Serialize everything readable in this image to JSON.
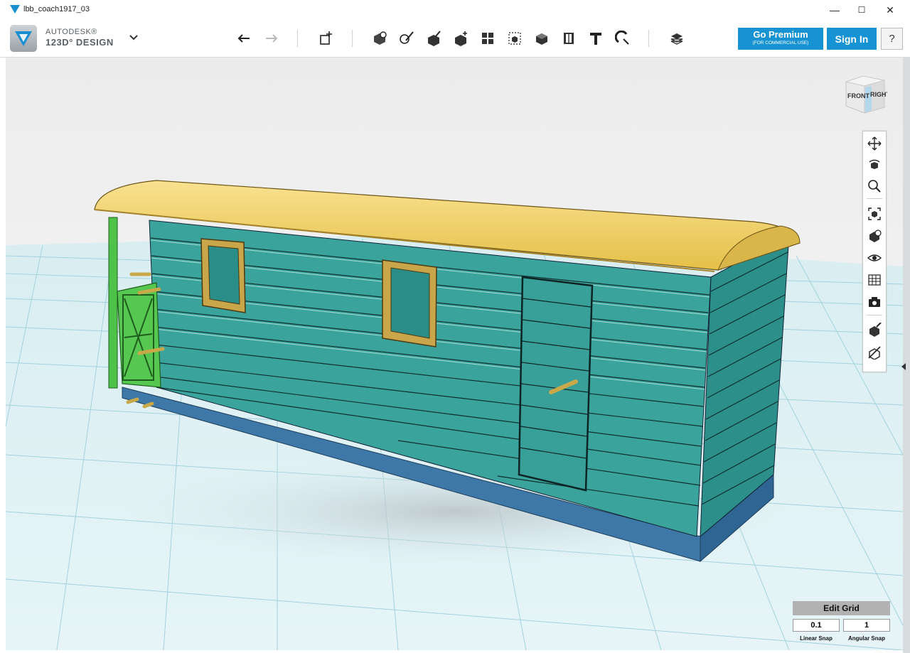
{
  "window": {
    "title": "lbb_coach1917_03",
    "minimize": "—",
    "maximize": "☐",
    "close": "✕"
  },
  "brand": {
    "line1": "AUTODESK®",
    "line2": "123D° DESIGN"
  },
  "toolbar": {
    "icons": [
      "undo-icon",
      "redo-icon",
      "primitives-icon",
      "sketch-icon",
      "construct-icon",
      "modify-icon",
      "pattern-icon",
      "grouping-icon",
      "combine-icon",
      "measure-icon",
      "text-icon",
      "snap-icon",
      "material-icon"
    ]
  },
  "account": {
    "premium_label": "Go Premium",
    "premium_sub": "(FOR COMMERCIAL USE)",
    "signin_label": "Sign In",
    "help_label": "?"
  },
  "viewcube": {
    "front": "FRONT",
    "right": "RIGHT"
  },
  "navbar": {
    "icons": [
      "pan-icon",
      "orbit-icon",
      "zoom-icon",
      "fit-icon",
      "view-icon",
      "visibility-icon",
      "materials-outline-icon",
      "screenshot-icon",
      "solid-icon",
      "hide-sketch-icon"
    ]
  },
  "grid": {
    "title": "Edit Grid",
    "linear_value": "0.1",
    "angular_value": "1",
    "linear_label": "Linear Snap",
    "angular_label": "Angular Snap"
  },
  "colors": {
    "accent": "#1793d4",
    "body": "#3aa39c",
    "roof": "#f2d064",
    "base": "#3d78a8",
    "rail": "#4fc24a"
  }
}
